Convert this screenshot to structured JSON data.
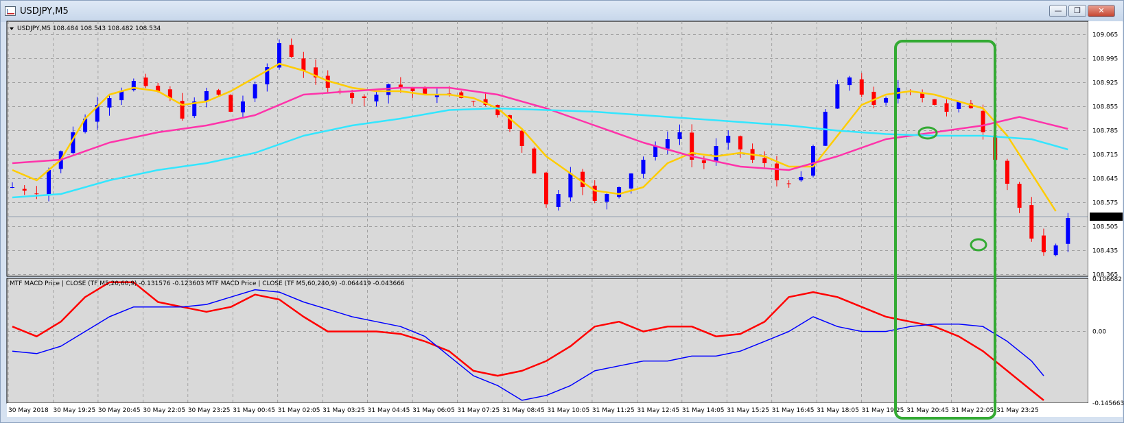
{
  "window": {
    "title": "USDJPY,M5",
    "buttons": {
      "minimize": "—",
      "restore": "❐",
      "close": "✕"
    }
  },
  "price_info": "USDJPY,M5  108.484 108.543 108.482 108.534",
  "macd_info": "MTF MACD Price | CLOSE  (TF M5,20,60,9) -0.131576 -0.123603  MTF MACD Price | CLOSE  (TF M5,60,240,9) -0.064419 -0.043666",
  "colors": {
    "background": "#d9d9d9",
    "grid": "#8c8c8c",
    "bull": "#0000ff",
    "bear": "#ff0000",
    "ma_fast": "#ffcc00",
    "ma_mid": "#ff33aa",
    "ma_slow": "#33e6ff",
    "macd_fast": "#ff0000",
    "macd_slow": "#0000ff",
    "annotation": "#33aa33",
    "current_price_label": "#000000"
  },
  "chart_data": [
    {
      "type": "candlestick",
      "symbol": "USDJPY",
      "timeframe": "M5",
      "ylim": [
        108.36,
        109.09
      ],
      "y_ticks": [
        "109.065",
        "108.995",
        "108.925",
        "108.855",
        "108.785",
        "108.715",
        "108.645",
        "108.575",
        "108.505",
        "108.435",
        "108.365"
      ],
      "current_price": "108.534",
      "x_labels": [
        "30 May 2018",
        "30 May 19:25",
        "30 May 20:45",
        "30 May 22:05",
        "30 May 23:25",
        "31 May 00:45",
        "31 May 02:05",
        "31 May 03:25",
        "31 May 04:45",
        "31 May 06:05",
        "31 May 07:25",
        "31 May 08:45",
        "31 May 10:05",
        "31 May 11:25",
        "31 May 12:45",
        "31 May 14:05",
        "31 May 15:25",
        "31 May 16:45",
        "31 May 18:05",
        "31 May 19:25",
        "31 May 20:45",
        "31 May 22:05",
        "31 May 23:25"
      ],
      "close_path": [
        [
          0,
          108.62
        ],
        [
          2,
          108.6
        ],
        [
          3,
          108.67
        ],
        [
          5,
          108.78
        ],
        [
          7,
          108.86
        ],
        [
          9,
          108.9
        ],
        [
          10,
          108.93
        ],
        [
          12,
          108.9
        ],
        [
          13,
          108.88
        ],
        [
          14,
          108.82
        ],
        [
          15,
          108.87
        ],
        [
          16,
          108.9
        ],
        [
          17,
          108.89
        ],
        [
          18,
          108.84
        ],
        [
          19,
          108.87
        ],
        [
          20,
          108.92
        ],
        [
          21,
          108.97
        ],
        [
          22,
          109.04
        ],
        [
          23,
          109
        ],
        [
          24,
          108.96
        ],
        [
          25,
          108.94
        ],
        [
          26,
          108.91
        ],
        [
          27,
          108.9
        ],
        [
          28,
          108.88
        ],
        [
          29,
          108.88
        ],
        [
          30,
          108.89
        ],
        [
          31,
          108.92
        ],
        [
          32,
          108.91
        ],
        [
          33,
          108.9
        ],
        [
          34,
          108.89
        ],
        [
          35,
          108.89
        ],
        [
          36,
          108.89
        ],
        [
          37,
          108.88
        ],
        [
          38,
          108.87
        ],
        [
          39,
          108.86
        ],
        [
          40,
          108.83
        ],
        [
          41,
          108.79
        ],
        [
          42,
          108.74
        ],
        [
          43,
          108.66
        ],
        [
          44,
          108.57
        ],
        [
          45,
          108.6
        ],
        [
          46,
          108.66
        ],
        [
          47,
          108.62
        ],
        [
          48,
          108.58
        ],
        [
          49,
          108.6
        ],
        [
          50,
          108.62
        ],
        [
          51,
          108.66
        ],
        [
          52,
          108.7
        ],
        [
          53,
          108.74
        ],
        [
          54,
          108.76
        ],
        [
          55,
          108.78
        ],
        [
          56,
          108.7
        ],
        [
          57,
          108.69
        ],
        [
          58,
          108.74
        ],
        [
          59,
          108.77
        ],
        [
          60,
          108.73
        ],
        [
          61,
          108.7
        ],
        [
          62,
          108.69
        ],
        [
          63,
          108.64
        ],
        [
          64,
          108.63
        ],
        [
          65,
          108.65
        ],
        [
          66,
          108.74
        ],
        [
          67,
          108.84
        ],
        [
          68,
          108.92
        ],
        [
          69,
          108.94
        ],
        [
          70,
          108.89
        ],
        [
          71,
          108.86
        ],
        [
          72,
          108.88
        ],
        [
          73,
          108.91
        ],
        [
          74,
          108.9
        ],
        [
          75,
          108.88
        ],
        [
          76,
          108.86
        ],
        [
          77,
          108.84
        ],
        [
          78,
          108.87
        ],
        [
          79,
          108.85
        ],
        [
          80,
          108.78
        ],
        [
          81,
          108.7
        ],
        [
          82,
          108.63
        ],
        [
          83,
          108.56
        ],
        [
          84,
          108.47
        ],
        [
          85,
          108.43
        ],
        [
          86,
          108.45
        ],
        [
          87,
          108.53
        ]
      ],
      "moving_averages": [
        {
          "name": "",
          "color_key": "ma_fast",
          "points": [
            [
              0,
              108.67
            ],
            [
              2,
              108.64
            ],
            [
              4,
              108.7
            ],
            [
              6,
              108.82
            ],
            [
              8,
              108.89
            ],
            [
              10,
              108.91
            ],
            [
              12,
              108.9
            ],
            [
              14,
              108.86
            ],
            [
              16,
              108.87
            ],
            [
              18,
              108.9
            ],
            [
              20,
              108.94
            ],
            [
              22,
              108.98
            ],
            [
              24,
              108.96
            ],
            [
              26,
              108.93
            ],
            [
              28,
              108.91
            ],
            [
              30,
              108.9
            ],
            [
              32,
              108.9
            ],
            [
              34,
              108.89
            ],
            [
              36,
              108.89
            ],
            [
              38,
              108.88
            ],
            [
              40,
              108.85
            ],
            [
              42,
              108.79
            ],
            [
              44,
              108.71
            ],
            [
              46,
              108.66
            ],
            [
              48,
              108.61
            ],
            [
              50,
              108.6
            ],
            [
              52,
              108.62
            ],
            [
              54,
              108.69
            ],
            [
              56,
              108.72
            ],
            [
              58,
              108.71
            ],
            [
              60,
              108.72
            ],
            [
              62,
              108.71
            ],
            [
              64,
              108.68
            ],
            [
              66,
              108.68
            ],
            [
              68,
              108.77
            ],
            [
              70,
              108.86
            ],
            [
              72,
              108.89
            ],
            [
              74,
              108.9
            ],
            [
              76,
              108.89
            ],
            [
              78,
              108.87
            ],
            [
              80,
              108.85
            ],
            [
              82,
              108.77
            ],
            [
              84,
              108.66
            ],
            [
              86,
              108.55
            ]
          ]
        },
        {
          "name": "",
          "color_key": "ma_mid",
          "points": [
            [
              0,
              108.69
            ],
            [
              4,
              108.7
            ],
            [
              8,
              108.75
            ],
            [
              12,
              108.78
            ],
            [
              16,
              108.8
            ],
            [
              20,
              108.83
            ],
            [
              24,
              108.89
            ],
            [
              28,
              108.9
            ],
            [
              32,
              108.91
            ],
            [
              36,
              108.91
            ],
            [
              40,
              108.89
            ],
            [
              44,
              108.85
            ],
            [
              48,
              108.8
            ],
            [
              52,
              108.75
            ],
            [
              56,
              108.71
            ],
            [
              60,
              108.68
            ],
            [
              64,
              108.67
            ],
            [
              68,
              108.71
            ],
            [
              72,
              108.76
            ],
            [
              76,
              108.78
            ],
            [
              80,
              108.8
            ],
            [
              83,
              108.825
            ],
            [
              87,
              108.79
            ]
          ]
        },
        {
          "name": "",
          "color_key": "ma_slow",
          "points": [
            [
              0,
              108.59
            ],
            [
              4,
              108.6
            ],
            [
              8,
              108.64
            ],
            [
              12,
              108.67
            ],
            [
              16,
              108.69
            ],
            [
              20,
              108.72
            ],
            [
              24,
              108.77
            ],
            [
              28,
              108.8
            ],
            [
              32,
              108.82
            ],
            [
              36,
              108.845
            ],
            [
              40,
              108.85
            ],
            [
              44,
              108.845
            ],
            [
              48,
              108.84
            ],
            [
              52,
              108.83
            ],
            [
              56,
              108.82
            ],
            [
              60,
              108.81
            ],
            [
              64,
              108.8
            ],
            [
              68,
              108.785
            ],
            [
              72,
              108.775
            ],
            [
              76,
              108.77
            ],
            [
              80,
              108.77
            ],
            [
              84,
              108.76
            ],
            [
              87,
              108.73
            ]
          ]
        }
      ]
    },
    {
      "type": "line",
      "title": "MTF MACD Price | CLOSE",
      "ylim": [
        -0.14566,
        0.10668
      ],
      "y_ticks": [
        "0.106682",
        "0.00",
        "-0.145663"
      ],
      "series": [
        {
          "name": "",
          "color_key": "macd_fast",
          "points": [
            [
              0,
              0.01
            ],
            [
              2,
              -0.01
            ],
            [
              4,
              0.02
            ],
            [
              6,
              0.07
            ],
            [
              8,
              0.1
            ],
            [
              10,
              0.1
            ],
            [
              12,
              0.06
            ],
            [
              14,
              0.05
            ],
            [
              16,
              0.04
            ],
            [
              18,
              0.05
            ],
            [
              20,
              0.075
            ],
            [
              22,
              0.065
            ],
            [
              24,
              0.03
            ],
            [
              26,
              0.0
            ],
            [
              28,
              0.0
            ],
            [
              30,
              0.0
            ],
            [
              32,
              -0.005
            ],
            [
              34,
              -0.02
            ],
            [
              36,
              -0.04
            ],
            [
              38,
              -0.08
            ],
            [
              40,
              -0.09
            ],
            [
              42,
              -0.08
            ],
            [
              44,
              -0.06
            ],
            [
              46,
              -0.03
            ],
            [
              48,
              0.01
            ],
            [
              50,
              0.02
            ],
            [
              52,
              0.0
            ],
            [
              54,
              0.01
            ],
            [
              56,
              0.01
            ],
            [
              58,
              -0.01
            ],
            [
              60,
              -0.005
            ],
            [
              62,
              0.02
            ],
            [
              64,
              0.07
            ],
            [
              66,
              0.08
            ],
            [
              68,
              0.07
            ],
            [
              70,
              0.05
            ],
            [
              72,
              0.03
            ],
            [
              74,
              0.02
            ],
            [
              76,
              0.01
            ],
            [
              78,
              -0.01
            ],
            [
              80,
              -0.04
            ],
            [
              82,
              -0.08
            ],
            [
              84,
              -0.12
            ],
            [
              85,
              -0.14
            ]
          ]
        },
        {
          "name": "",
          "color_key": "macd_slow",
          "points": [
            [
              0,
              -0.04
            ],
            [
              2,
              -0.045
            ],
            [
              4,
              -0.03
            ],
            [
              6,
              0.0
            ],
            [
              8,
              0.03
            ],
            [
              10,
              0.05
            ],
            [
              12,
              0.05
            ],
            [
              14,
              0.05
            ],
            [
              16,
              0.055
            ],
            [
              18,
              0.07
            ],
            [
              20,
              0.085
            ],
            [
              22,
              0.08
            ],
            [
              24,
              0.06
            ],
            [
              26,
              0.045
            ],
            [
              28,
              0.03
            ],
            [
              30,
              0.02
            ],
            [
              32,
              0.01
            ],
            [
              34,
              -0.01
            ],
            [
              36,
              -0.05
            ],
            [
              38,
              -0.09
            ],
            [
              40,
              -0.11
            ],
            [
              42,
              -0.14
            ],
            [
              44,
              -0.13
            ],
            [
              46,
              -0.11
            ],
            [
              48,
              -0.08
            ],
            [
              50,
              -0.07
            ],
            [
              52,
              -0.06
            ],
            [
              54,
              -0.06
            ],
            [
              56,
              -0.05
            ],
            [
              58,
              -0.05
            ],
            [
              60,
              -0.04
            ],
            [
              62,
              -0.02
            ],
            [
              64,
              0.0
            ],
            [
              66,
              0.03
            ],
            [
              68,
              0.01
            ],
            [
              70,
              0.0
            ],
            [
              72,
              0.0
            ],
            [
              74,
              0.01
            ],
            [
              76,
              0.015
            ],
            [
              78,
              0.015
            ],
            [
              80,
              0.01
            ],
            [
              82,
              -0.02
            ],
            [
              84,
              -0.06
            ],
            [
              85,
              -0.09
            ]
          ]
        }
      ]
    }
  ]
}
